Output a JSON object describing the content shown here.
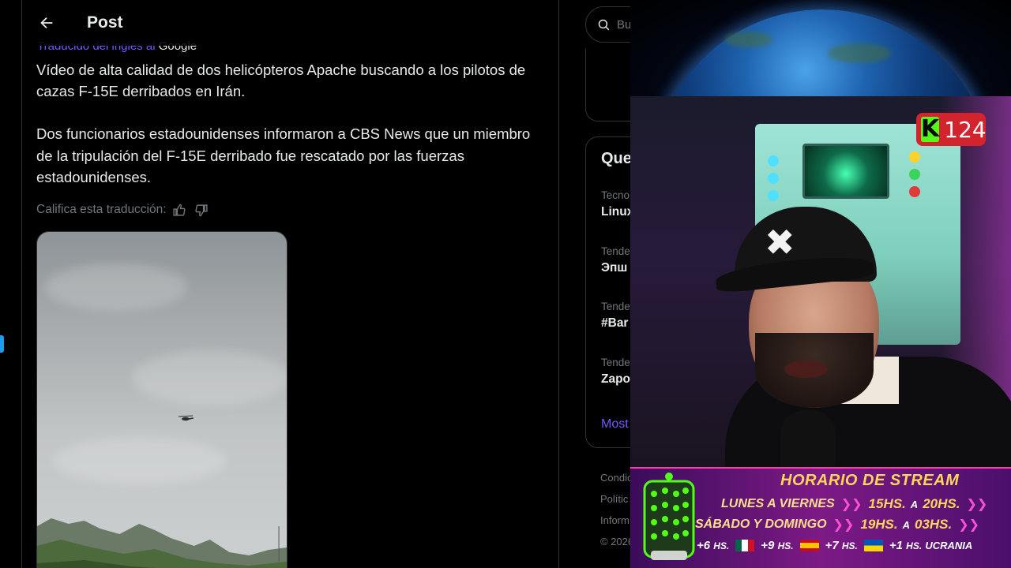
{
  "header": {
    "title": "Post"
  },
  "post": {
    "translated_by_prefix": "Traducido del inglés al",
    "translated_by_brand": "Google",
    "paragraph_1": "Vídeo de alta calidad de dos helicópteros Apache buscando a los pilotos de cazas F-15E derribados en Irán.",
    "paragraph_2": "Dos funcionarios estadounidenses informaron a CBS News que un miembro de la tripulación del F-15E derribado fue rescatado por las fuerzas estadounidenses.",
    "rate_label": "Califica esta traducción:"
  },
  "search": {
    "placeholder": "Bu"
  },
  "trends": {
    "title": "Que",
    "items": [
      {
        "category": "Tecno",
        "name": "Linux"
      },
      {
        "category": "Tende",
        "name": "Эпш"
      },
      {
        "category": "Tende",
        "name": "#Bar"
      },
      {
        "category": "Tende",
        "name": "Zapo"
      }
    ],
    "show_more": "Most"
  },
  "footer": {
    "links": [
      "Condic",
      "Polític",
      "Inform",
      "© 2026"
    ]
  },
  "stream": {
    "kick_count": "124",
    "schedule_title": "HORARIO DE STREAM",
    "rows": [
      {
        "day": "LUNES A VIERNES",
        "from": "15HS.",
        "sep": "A",
        "to": "20HS."
      },
      {
        "day": "SÁBADO Y DOMINGO",
        "from": "19HS.",
        "sep": "A",
        "to": "03HS."
      }
    ],
    "timezones": [
      {
        "offset": "+6",
        "unit": "HS."
      },
      {
        "offset": "+9",
        "unit": "HS."
      },
      {
        "offset": "+7",
        "unit": "HS."
      },
      {
        "offset": "+1",
        "unit": "HS.",
        "label": "UCRANIA"
      }
    ]
  }
}
